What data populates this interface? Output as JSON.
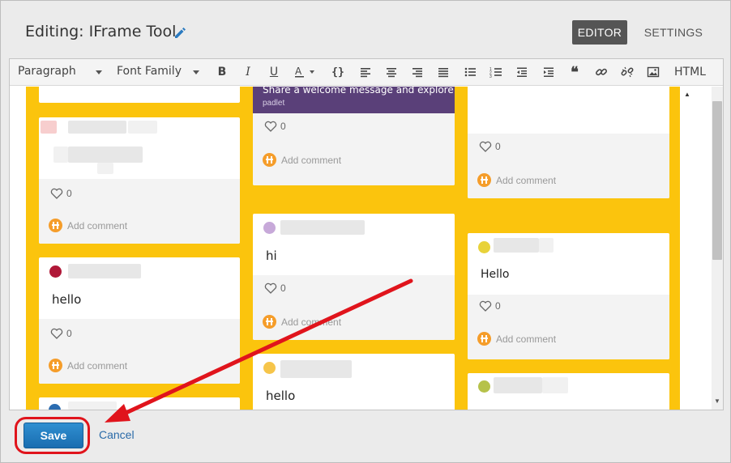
{
  "dialog": {
    "title": "Editing: IFrame Tool",
    "tabs": [
      {
        "label": "EDITOR",
        "active": true
      },
      {
        "label": "SETTINGS",
        "active": false
      }
    ]
  },
  "toolbar": {
    "paragraph_label": "Paragraph",
    "font_family_label": "Font Family",
    "html_label": "HTML",
    "buttons": [
      "bold-icon",
      "italic-icon",
      "underline-icon",
      "text-color-icon",
      "code-icon",
      "align-left-icon",
      "align-center-icon",
      "align-right-icon",
      "align-justify-icon",
      "bullet-list-icon",
      "numbered-list-icon",
      "outdent-icon",
      "indent-icon",
      "blockquote-icon",
      "link-icon",
      "unlink-icon",
      "image-icon"
    ]
  },
  "padlet": {
    "background": "#fbc40d",
    "add_comment_label": "Add comment",
    "cards": [
      {
        "column": 1,
        "text": "",
        "likes": "0"
      },
      {
        "column": 1,
        "text": "hello",
        "likes": "0"
      },
      {
        "column": 2,
        "title": "Share a welcome message and explore ...",
        "subtitle": "padlet",
        "likes": "0"
      },
      {
        "column": 2,
        "text": "hi",
        "likes": "0"
      },
      {
        "column": 2,
        "text": "hello"
      },
      {
        "column": 3,
        "text": "",
        "likes": "0"
      },
      {
        "column": 3,
        "text": "Hello",
        "likes": "0"
      }
    ]
  },
  "footer": {
    "save_label": "Save",
    "cancel_label": "Cancel"
  },
  "colors": {
    "annotation": "#e0141c",
    "primary_button": "#2080c4",
    "header_card": "#5a4079"
  }
}
